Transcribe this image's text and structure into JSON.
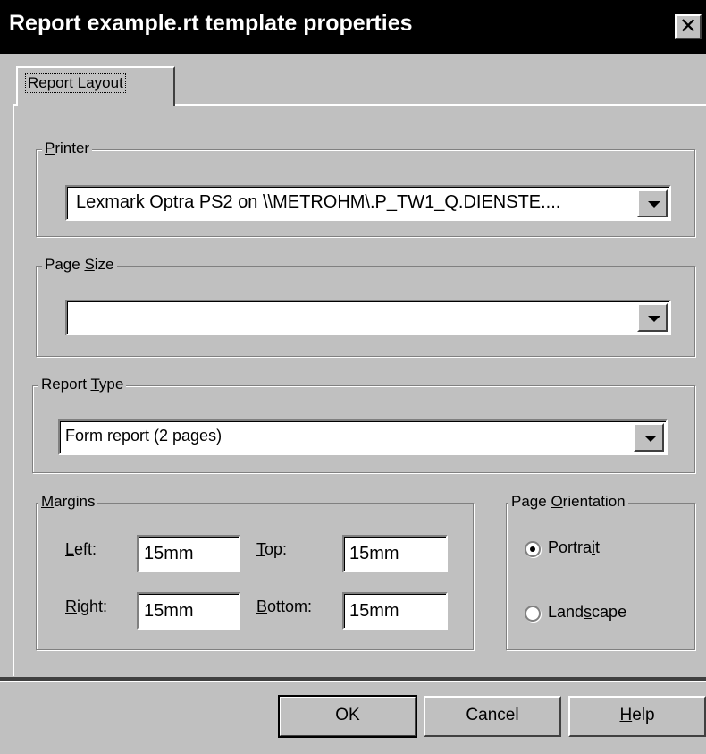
{
  "window": {
    "title": "Report example.rt template properties",
    "close_label": "✕"
  },
  "tabs": [
    {
      "label": "Report Layout",
      "selected": true
    }
  ],
  "printer": {
    "group_label_prefix": "",
    "group_label_mnemonic": "P",
    "group_label_suffix": "rinter",
    "selected_value": "Lexmark Optra PS2 on \\\\METROHM\\.P_TW1_Q.DIENSTE...."
  },
  "page_size": {
    "group_label_prefix": "Page ",
    "group_label_mnemonic": "S",
    "group_label_suffix": "ize",
    "selected_value": ""
  },
  "report_type": {
    "group_label_prefix": "Report ",
    "group_label_mnemonic": "T",
    "group_label_suffix": "ype",
    "selected_value": "Form report (2 pages)"
  },
  "margins": {
    "group_label_prefix": "",
    "group_label_mnemonic": "M",
    "group_label_suffix": "argins",
    "left": {
      "label_mnemonic": "L",
      "label_suffix": "eft:",
      "value": "15mm"
    },
    "top": {
      "label_mnemonic": "T",
      "label_suffix": "op:",
      "value": "15mm"
    },
    "right": {
      "label_mnemonic": "R",
      "label_suffix": "ight:",
      "value": "15mm"
    },
    "bottom": {
      "label_mnemonic": "B",
      "label_suffix": "ottom:",
      "value": "15mm"
    }
  },
  "orientation": {
    "group_label_prefix": "Page ",
    "group_label_mnemonic": "O",
    "group_label_suffix": "rientation",
    "portrait": {
      "label_prefix": "Portra",
      "label_mnemonic": "i",
      "label_suffix": "t",
      "checked": true
    },
    "landscape": {
      "label_prefix": "Land",
      "label_mnemonic": "s",
      "label_suffix": "cape",
      "checked": false
    }
  },
  "buttons": {
    "ok": "OK",
    "cancel": "Cancel",
    "help_mnemonic": "H",
    "help_suffix": "elp"
  }
}
